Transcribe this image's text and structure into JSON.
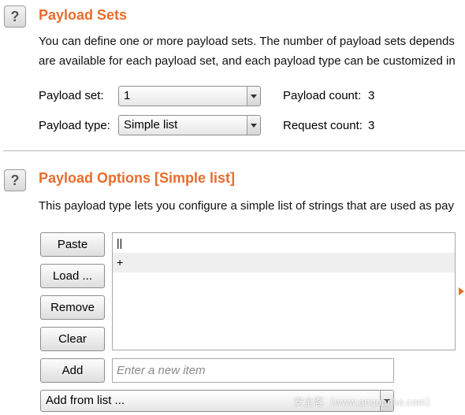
{
  "payload_sets": {
    "title": "Payload Sets",
    "desc_line1": "You can define one or more payload sets. The number of payload sets depends",
    "desc_line2": "are available for each payload set, and each payload type can be customized in",
    "set_label": "Payload set:",
    "set_value": "1",
    "type_label": "Payload type:",
    "type_value": "Simple list",
    "payload_count_label": "Payload count:",
    "payload_count": "3",
    "request_count_label": "Request count:",
    "request_count": "3"
  },
  "payload_options": {
    "title": "Payload Options [Simple list]",
    "desc": "This payload type lets you configure a simple list of strings that are used as pay",
    "buttons": {
      "paste": "Paste",
      "load": "Load ...",
      "remove": "Remove",
      "clear": "Clear",
      "add": "Add"
    },
    "items": [
      "||",
      "+",
      ""
    ],
    "new_item_placeholder": "Enter a new item",
    "add_from_list": "Add from list ..."
  },
  "watermark": "安全客（www.anquanke.com）",
  "colors": {
    "accent": "#e86c2c"
  },
  "icons": {
    "help": "help-icon",
    "dropdown": "chevron-down-icon",
    "marker": "triangle-right-icon"
  }
}
